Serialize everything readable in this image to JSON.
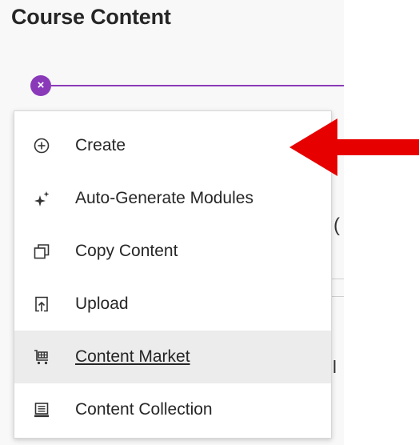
{
  "header": {
    "title": "Course Content"
  },
  "menu": {
    "items": [
      {
        "label": "Create",
        "icon": "plus-circle-icon"
      },
      {
        "label": "Auto-Generate Modules",
        "icon": "sparkle-icon"
      },
      {
        "label": "Copy Content",
        "icon": "copy-icon"
      },
      {
        "label": "Upload",
        "icon": "upload-icon"
      },
      {
        "label": "Content Market",
        "icon": "cart-icon",
        "hovered": true
      },
      {
        "label": "Content Collection",
        "icon": "collection-icon"
      }
    ]
  },
  "colors": {
    "accent": "#8a3ab9",
    "annotation_arrow": "#e60000",
    "hover_bg": "#ececec"
  }
}
